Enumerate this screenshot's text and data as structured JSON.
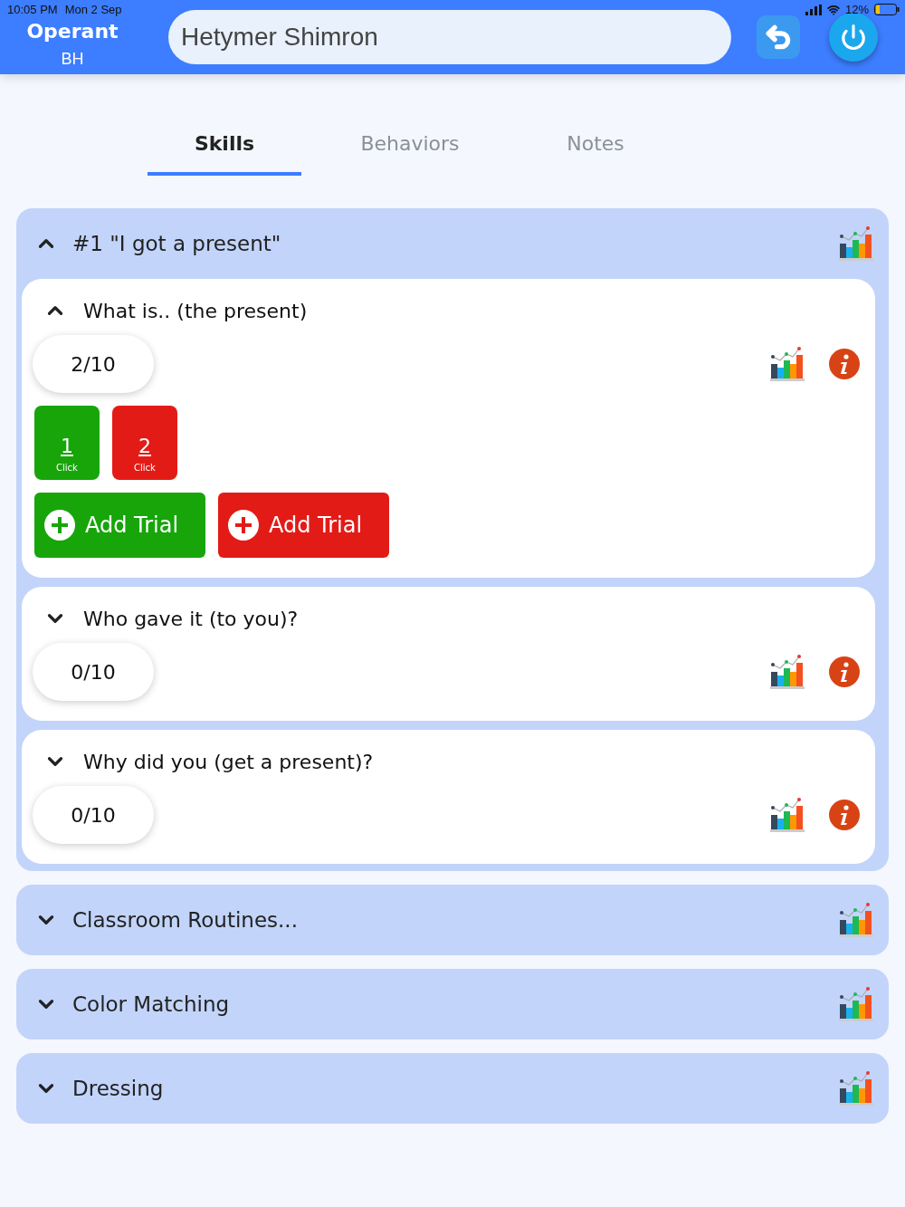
{
  "status_bar": {
    "time": "10:05 PM",
    "date": "Mon 2 Sep",
    "battery": "12%"
  },
  "header": {
    "app_title": "Operant",
    "initials": "BH",
    "student_field": {
      "value": "Hetymer Shimron"
    }
  },
  "tabs": [
    {
      "label": "Skills",
      "selected": true
    },
    {
      "label": "Behaviors",
      "selected": false
    },
    {
      "label": "Notes",
      "selected": false
    }
  ],
  "programs": [
    {
      "title": "#1 \"I got a present\"",
      "expanded": true,
      "targets": [
        {
          "title": "What is.. (the present)",
          "expanded": true,
          "score": "2/10",
          "counters": [
            {
              "number": "1",
              "label": "Click",
              "color": "#17a50a"
            },
            {
              "number": "2",
              "label": "Click",
              "color": "#e31b17"
            }
          ],
          "add_buttons": [
            {
              "label": "Add Trial",
              "color": "#17a50a"
            },
            {
              "label": "Add Trial",
              "color": "#e31b17"
            }
          ]
        },
        {
          "title": "Who gave it (to you)?",
          "expanded": false,
          "score": "0/10"
        },
        {
          "title": "Why did you (get a present)?",
          "expanded": false,
          "score": "0/10"
        }
      ]
    },
    {
      "title": "Classroom Routines...",
      "expanded": false
    },
    {
      "title": "Color Matching",
      "expanded": false
    },
    {
      "title": "Dressing",
      "expanded": false
    }
  ]
}
